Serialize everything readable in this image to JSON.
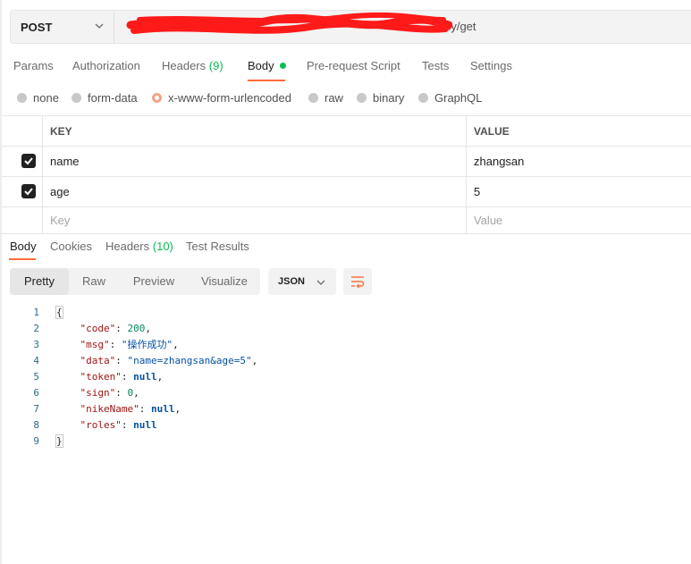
{
  "request": {
    "method": "POST",
    "url_visible": "/efly/get"
  },
  "request_tabs": [
    {
      "label": "Params"
    },
    {
      "label": "Authorization"
    },
    {
      "label": "Headers",
      "count": "(9)"
    },
    {
      "label": "Body"
    },
    {
      "label": "Pre-request Script"
    },
    {
      "label": "Tests"
    },
    {
      "label": "Settings"
    }
  ],
  "body_types": [
    "none",
    "form-data",
    "x-www-form-urlencoded",
    "raw",
    "binary",
    "GraphQL"
  ],
  "body_type_selected": "x-www-form-urlencoded",
  "params_table": {
    "headers": [
      "KEY",
      "VALUE"
    ],
    "rows": [
      {
        "key": "name",
        "value": "zhangsan",
        "checked": true
      },
      {
        "key": "age",
        "value": "5",
        "checked": true
      }
    ],
    "placeholder": {
      "key": "Key",
      "value": "Value"
    }
  },
  "response_tabs": [
    {
      "label": "Body"
    },
    {
      "label": "Cookies"
    },
    {
      "label": "Headers",
      "count": "(10)"
    },
    {
      "label": "Test Results"
    }
  ],
  "view_modes": [
    "Pretty",
    "Raw",
    "Preview",
    "Visualize"
  ],
  "format": "JSON",
  "response_lines": [
    {
      "num": "1",
      "text": "{"
    },
    {
      "num": "2",
      "text": "    \"code\": 200,"
    },
    {
      "num": "3",
      "text": "    \"msg\": \"操作成功\","
    },
    {
      "num": "4",
      "text": "    \"data\": \"name=zhangsan&age=5\","
    },
    {
      "num": "5",
      "text": "    \"token\": null,"
    },
    {
      "num": "6",
      "text": "    \"sign\": 0,"
    },
    {
      "num": "7",
      "text": "    \"nikeName\": null,"
    },
    {
      "num": "8",
      "text": "    \"roles\": null"
    },
    {
      "num": "9",
      "text": "}"
    }
  ],
  "colors": {
    "accent": "#ff6c37",
    "count_green": "#0cbb52",
    "json_key": "#a31515",
    "json_string": "#0451a5",
    "json_number": "#098658",
    "redaction": "#ff1a1a"
  },
  "icons": [
    "chevron-down-icon",
    "checkmark-icon",
    "wrap-lines-icon"
  ]
}
